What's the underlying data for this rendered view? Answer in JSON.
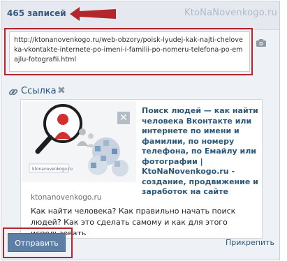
{
  "header": {
    "count": "465 записей",
    "watermark": "KtoNaNovenkogo.ru"
  },
  "composer": {
    "link_text": "http://ktonanovenkogo.ru/web-obzory/poisk-lyudej-kak-najti-cheloveka-vkontakte-internete-po-imeni-i-familii-po-nomeru-telefona-po-emajlu-fotografii.html",
    "camera_icon": "camera-icon"
  },
  "attachment": {
    "label": "Ссылка",
    "remove": "✖",
    "close": "✕",
    "title": "Поиск людей — как найти человека Вконтакте или интернете по имени и фамилии, по номеру телефона, по Емайлу или фотографии | KtoNaNovenkogo.ru - создание, продвижение и заработок на сайте",
    "domain": "ktonanovenkogo.ru",
    "description": "Как найти человека? Как правильно начать поиск людей? Как это сделать самому и как для этого использовать",
    "thumb_site": "ktonanovenkogo.ru"
  },
  "actions": {
    "send_label": "Отправить",
    "attach_label": "Прикрепить"
  },
  "colors": {
    "accent": "#2b587a",
    "highlight": "#b3262b",
    "button": "#5d7fa6"
  }
}
